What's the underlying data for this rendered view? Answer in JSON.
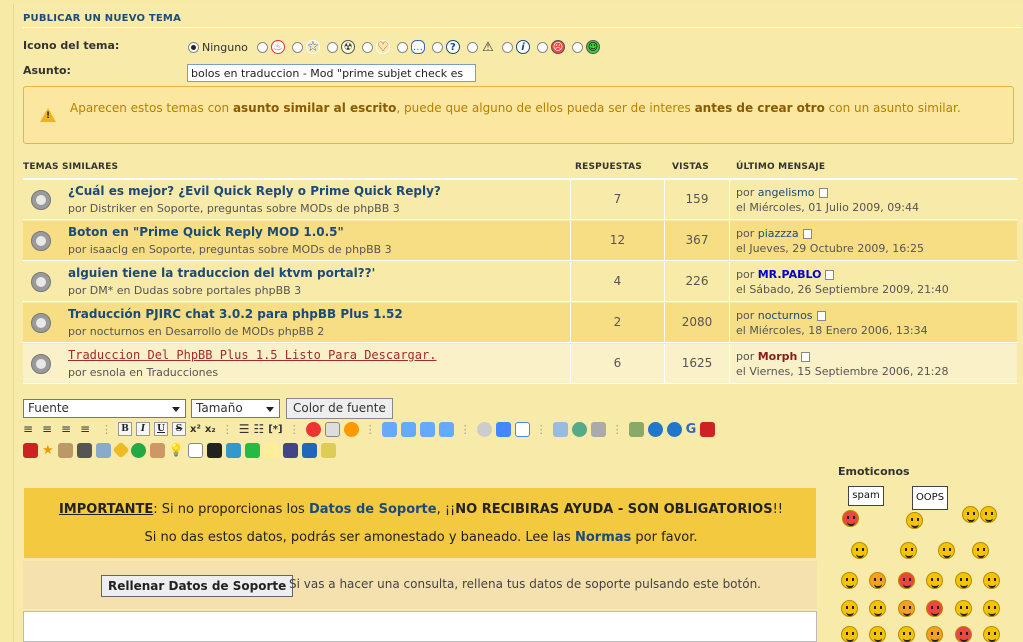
{
  "header": {
    "title": "PUBLICAR UN NUEVO TEMA"
  },
  "form": {
    "icon_label": "Icono del tema:",
    "icon_none": "Ninguno",
    "icons": [
      "fire-icon",
      "star-icon",
      "radioactive-icon",
      "heart-icon",
      "speech-icon",
      "question-icon",
      "warning-icon",
      "info-icon",
      "sad-face-icon",
      "happy-face-icon"
    ],
    "subject_label": "Asunto:",
    "subject_value": "bolos en traduccion - Mod \"prime subjet check es"
  },
  "notice": {
    "p1": "Aparecen estos temas con ",
    "b1": "asunto similar al escrito",
    "p2": ", puede que alguno de ellos pueda ser de interes ",
    "b2": "antes de crear otro",
    "p3": " con un asunto similar."
  },
  "similar": {
    "headers": {
      "topics": "TEMAS SIMILARES",
      "replies": "RESPUESTAS",
      "views": "VISTAS",
      "last": "ÚLTIMO MENSAJE"
    },
    "rows": [
      {
        "title": "¿Cuál es mejor? ¿Evil Quick Reply o Prime Quick Reply?",
        "by": "por Distriker en Soporte, preguntas sobre MODs de phpBB 3",
        "replies": "7",
        "views": "159",
        "last_by": "angelismo",
        "last_prefix": "por ",
        "last_date": "el Miércoles, 01 Julio 2009, 09:44",
        "bg": "#f8eaa8"
      },
      {
        "title": "Boton en \"Prime Quick Reply MOD 1.0.5\"",
        "by": "por isaaclg en Soporte, preguntas sobre MODs de phpBB 3",
        "replies": "12",
        "views": "367",
        "last_by": "piazzza",
        "last_prefix": "por ",
        "last_date": "el Jueves, 29 Octubre 2009, 16:25",
        "bg": "#f7de85"
      },
      {
        "title": "alguien tiene la traduccion del ktvm portal??'",
        "by": "por DM* en Dudas sobre portales phpBB 3",
        "replies": "4",
        "views": "226",
        "last_by": "MR.PABLO",
        "last_prefix": "por ",
        "last_date": "el Sábado, 26 Septiembre 2009, 21:40",
        "bg": "#f8eaa8"
      },
      {
        "title": "Traducción PJIRC chat 3.0.2 para phpBB Plus 1.52",
        "by": "por nocturnos en Desarrollo de MODs phpBB 2",
        "replies": "2",
        "views": "2080",
        "last_by": "nocturnos",
        "last_prefix": "por ",
        "last_date": "el Miércoles, 18 Enero 2006, 13:34",
        "bg": "#f7de85"
      },
      {
        "title": "Traduccion Del PhpBB Plus 1.5 Listo Para Descargar.",
        "by": "por esnola en Traducciones",
        "replies": "6",
        "views": "1625",
        "last_by": "Morph",
        "last_prefix": "por ",
        "last_date": "el Viernes, 15 Septiembre 2006, 21:28",
        "bg": "#faf1c9"
      }
    ]
  },
  "editor": {
    "font_select": "Fuente",
    "size_select": "Tamaño",
    "color_button": "Color de fuente",
    "format_buttons": [
      "B",
      "I",
      "U",
      "S",
      "x²",
      "x₂"
    ]
  },
  "emoticons": {
    "title": "Emoticonos",
    "sign_spam": "spam",
    "sign_oops": "OOPS"
  },
  "important": {
    "label": "IMPORTANTE",
    "t1": ": Si no proporcionas los ",
    "link1": "Datos de Soporte",
    "t2": ", ¡¡",
    "bold": "NO RECIBIRAS AYUDA - SON OBLIGATORIOS",
    "t3": "!!",
    "line2a": "Si no das estos datos, podrás ser amonestado y baneado. Lee las ",
    "link2": "Normas",
    "line2b": " por favor."
  },
  "support": {
    "button": "Rellenar Datos de Soporte",
    "hint": "Si vas a hacer una consulta, rellena tus datos de soporte pulsando este botón."
  }
}
